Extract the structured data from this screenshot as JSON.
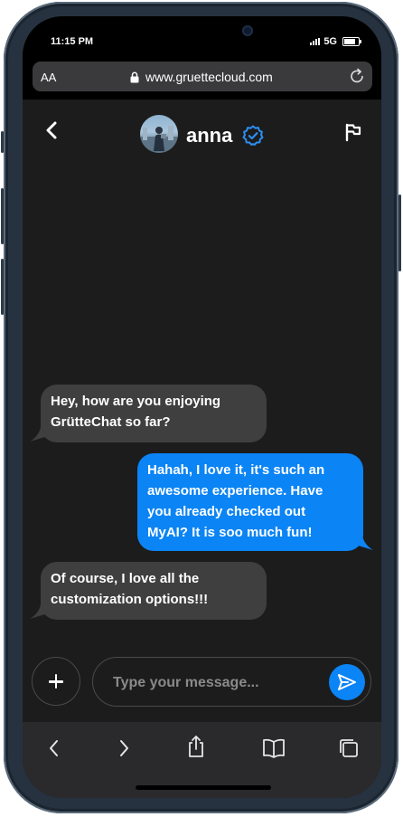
{
  "status_bar": {
    "time": "11:15 PM",
    "network": "5G"
  },
  "browser": {
    "text_size_label": "AA",
    "url": "www.gruettecloud.com"
  },
  "header": {
    "contact_name": "anna",
    "verified": true
  },
  "messages": [
    {
      "direction": "incoming",
      "text_lines": [
        "Hey, how are you enjoying",
        "GrütteChat so far?"
      ]
    },
    {
      "direction": "outgoing",
      "text_lines": [
        "Hahah, I love it, it's such an",
        "awesome experience. Have",
        "you already checked out",
        "MyAI? It is soo much fun!"
      ]
    },
    {
      "direction": "incoming",
      "text_lines": [
        "Of course, I love all the",
        "customization options!!!"
      ]
    }
  ],
  "composer": {
    "placeholder": "Type your message..."
  },
  "colors": {
    "accent": "#0b84f5",
    "incoming_bubble": "#3f3f3f",
    "background": "#1c1c1c"
  },
  "bottom_nav": {
    "icons": [
      "chevron-left-icon",
      "chevron-right-icon",
      "share-icon",
      "bookmarks-icon",
      "tabs-icon"
    ]
  }
}
